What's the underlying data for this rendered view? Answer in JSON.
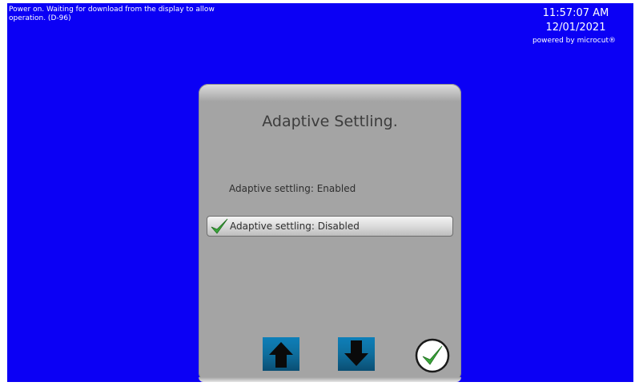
{
  "status_message": "Power on. Waiting for download from the display to allow operation. (D-96)",
  "clock": {
    "time": "11:57:07 AM",
    "date": "12/01/2021",
    "brand": "powered by microcut®"
  },
  "dialog": {
    "title": "Adaptive Settling.",
    "options": [
      {
        "label": "Adaptive settling: Enabled",
        "selected": false
      },
      {
        "label": "Adaptive settling: Disabled",
        "selected": true
      }
    ],
    "buttons": {
      "up_icon": "arrow-up-icon",
      "down_icon": "arrow-down-icon",
      "confirm_icon": "checkmark-circle-icon"
    }
  },
  "colors": {
    "background": "#0b00f5",
    "dialog": "#a4a4a4",
    "arrow_button": "#0f6e9d",
    "checkmark": "#3aa63a"
  }
}
